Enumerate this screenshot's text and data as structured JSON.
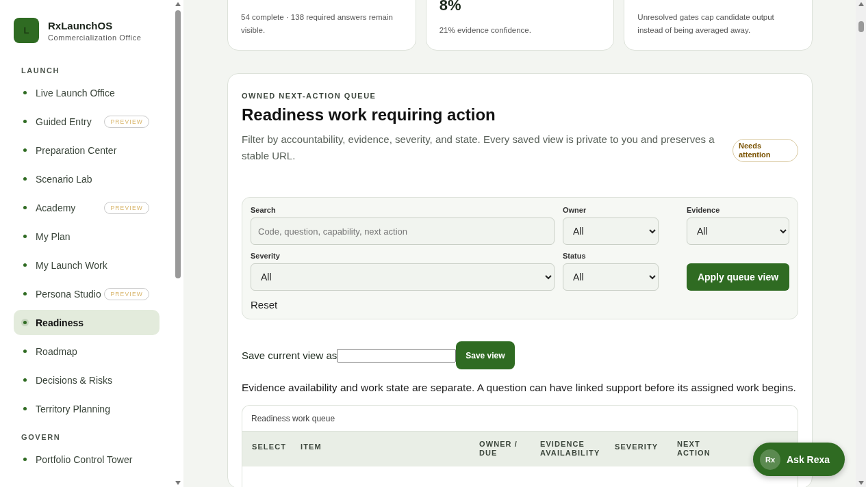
{
  "app": {
    "logo_letter": "L",
    "name": "RxLaunchOS",
    "subtitle": "Commercialization Office"
  },
  "sidebar": {
    "sections": [
      {
        "title": "LAUNCH",
        "items": [
          {
            "label": "Live Launch Office",
            "selected": false
          },
          {
            "label": "Guided Entry",
            "badge": "PREVIEW",
            "selected": false
          },
          {
            "label": "Preparation Center",
            "selected": false
          },
          {
            "label": "Scenario Lab",
            "selected": false
          },
          {
            "label": "Academy",
            "badge": "PREVIEW",
            "selected": false
          },
          {
            "label": "My Plan",
            "selected": false
          },
          {
            "label": "My Launch Work",
            "selected": false
          },
          {
            "label": "Persona Studio",
            "badge": "PREVIEW",
            "selected": false
          },
          {
            "label": "Readiness",
            "selected": true
          },
          {
            "label": "Roadmap",
            "selected": false
          },
          {
            "label": "Decisions & Risks",
            "selected": false
          },
          {
            "label": "Territory Planning",
            "selected": false
          }
        ]
      },
      {
        "title": "GOVERN",
        "items": [
          {
            "label": "Portfolio Control Tower",
            "selected": false
          }
        ]
      }
    ]
  },
  "summary_cards": [
    {
      "text": "54 complete · 138 required answers remain visible."
    },
    {
      "value": "8%",
      "text": "21% evidence confidence."
    },
    {
      "text": "Unresolved gates cap candidate output instead of being averaged away."
    }
  ],
  "queue_panel": {
    "eyebrow": "OWNED NEXT-ACTION QUEUE",
    "title": "Readiness work requiring action",
    "description": "Filter by accountability, evidence, severity, and state. Every saved view is private to you and preserves a stable URL.",
    "status_badge": "Needs attention",
    "filters": {
      "search": {
        "label": "Search",
        "placeholder": "Code, question, capability, next action"
      },
      "owner": {
        "label": "Owner",
        "value": "All"
      },
      "evidence": {
        "label": "Evidence",
        "value": "All"
      },
      "severity": {
        "label": "Severity",
        "value": "All"
      },
      "status": {
        "label": "Status",
        "value": "All"
      },
      "apply_button": "Apply queue view",
      "reset": "Reset"
    },
    "save_view": {
      "label": "Save current view as",
      "button": "Save view"
    },
    "note": "Evidence availability and work state are separate. A question can have linked support before its assigned work begins.",
    "table": {
      "caption": "Readiness work queue",
      "columns": [
        "SELECT",
        "ITEM",
        "OWNER / DUE",
        "EVIDENCE AVAILABILITY",
        "SEVERITY",
        "NEXT ACTION"
      ]
    }
  },
  "assistant_button": {
    "avatar": "Rx",
    "label": "Ask Rexa"
  }
}
